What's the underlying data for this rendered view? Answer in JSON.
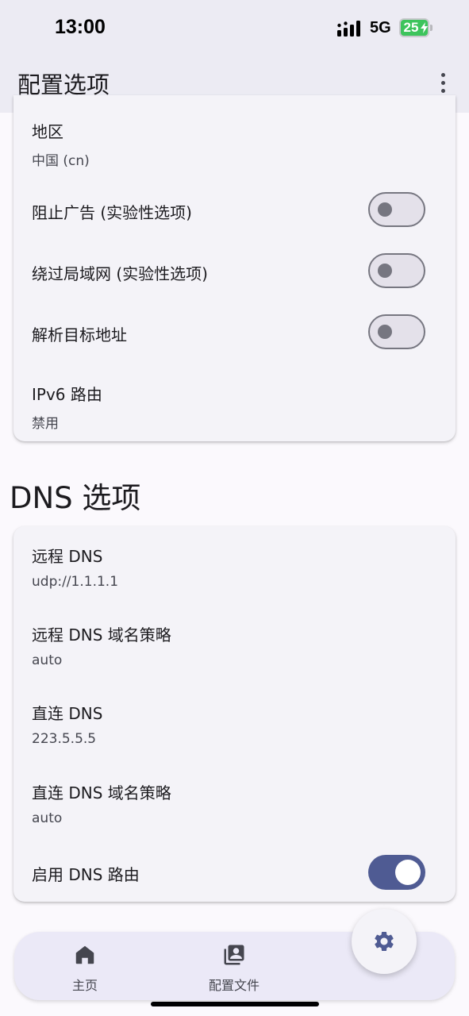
{
  "status_bar": {
    "time": "13:00",
    "network": "5G",
    "battery": "25",
    "icons": [
      "signal-icon",
      "battery-icon",
      "charging-bolt-icon"
    ]
  },
  "app_bar": {
    "title": "配置选项",
    "more_icon": "more-vert-icon"
  },
  "routing_card": {
    "region": {
      "title": "地区",
      "value": "中国 (cn)"
    },
    "block_ads": {
      "title": "阻止广告 (实验性选项)",
      "enabled": false
    },
    "bypass_lan": {
      "title": "绕过局域网 (实验性选项)",
      "enabled": false
    },
    "resolve_destination": {
      "title": "解析目标地址",
      "enabled": false
    },
    "ipv6_route": {
      "title": "IPv6 路由",
      "value": "禁用"
    }
  },
  "dns_section": {
    "heading": "DNS 选项",
    "remote_dns": {
      "title": "远程 DNS",
      "value": "udp://1.1.1.1"
    },
    "remote_dns_strategy": {
      "title": "远程 DNS 域名策略",
      "value": "auto"
    },
    "direct_dns": {
      "title": "直连 DNS",
      "value": "223.5.5.5"
    },
    "direct_dns_strategy": {
      "title": "直连 DNS 域名策略",
      "value": "auto"
    },
    "enable_dns_routing": {
      "title": "启用 DNS 路由",
      "enabled": true
    }
  },
  "bottom_nav": {
    "home": {
      "label": "主页",
      "icon": "home-icon"
    },
    "profiles": {
      "label": "配置文件",
      "icon": "profiles-icon"
    },
    "settings_fab_icon": "gear-icon"
  },
  "colors": {
    "accent": "#4f5b93",
    "surface": "#f4f3f8",
    "app_bar": "#ecebf3",
    "battery": "#3dc45c"
  }
}
